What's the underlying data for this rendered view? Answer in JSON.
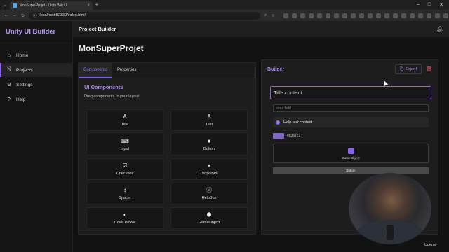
{
  "browser": {
    "tab_title": "MonSuperProjet - Unity Win U",
    "url": "localhost:52330/index.html"
  },
  "sidebar": {
    "brand": "Unity UI Builder",
    "items": [
      {
        "label": "Home",
        "icon": "home-icon"
      },
      {
        "label": "Projects",
        "icon": "projects-icon"
      },
      {
        "label": "Settings",
        "icon": "gear-icon"
      },
      {
        "label": "Help",
        "icon": "help-icon"
      }
    ]
  },
  "header": {
    "title": "Project Builder"
  },
  "project": {
    "name": "MonSuperProjet"
  },
  "left_panel": {
    "tabs": [
      "Components",
      "Properties"
    ],
    "section_title": "UI Components",
    "section_subtitle": "Drag components to your layout.",
    "components": [
      {
        "label": "Title",
        "glyph": "A"
      },
      {
        "label": "Text",
        "glyph": "A"
      },
      {
        "label": "Input",
        "glyph": "⌨"
      },
      {
        "label": "Button",
        "glyph": "■"
      },
      {
        "label": "Checkbox",
        "glyph": "☑"
      },
      {
        "label": "Dropdown",
        "glyph": "▾"
      },
      {
        "label": "Spacer",
        "glyph": "↕"
      },
      {
        "label": "HelpBox",
        "glyph": "ⓘ"
      },
      {
        "label": "Color Picker",
        "glyph": "◐"
      },
      {
        "label": "GameObject",
        "glyph": "⬢"
      }
    ]
  },
  "builder": {
    "title": "Builder",
    "export_label": "Export",
    "title_content": "Title content",
    "input_placeholder": "Input field",
    "help_text": "Help text content",
    "color_value": "#8367c7",
    "gameobject_label": "GameObject",
    "button_label": "Button"
  },
  "watermark": "Udemy",
  "colors": {
    "accent": "#8a63e6",
    "picked": "#8367c7",
    "danger": "#e05a5a"
  }
}
